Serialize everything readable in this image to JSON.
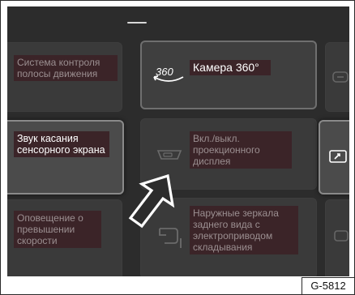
{
  "menu": {
    "items": [
      {
        "label": "Система контроля полосы движения",
        "icon": "lane-assist-icon"
      },
      {
        "label": "Камера 360°",
        "icon": "camera-360-icon",
        "icon_text": "360"
      },
      {
        "label": "Звук касания сенсорного экрана",
        "icon": "touch-sound-icon"
      },
      {
        "label": "Вкл./выкл. проекционного дисплея",
        "icon": "head-up-display-icon"
      },
      {
        "label": "Оповещение о превышении скорости",
        "icon": "speed-warning-icon"
      },
      {
        "label": "Наружные зеркала заднего вида с электроприводом складывания",
        "icon": "mirror-fold-icon"
      }
    ]
  },
  "figure_code": "G-5812",
  "colors": {
    "screen_bg": "#2c2c2c",
    "label_bg": "#3b2428",
    "dim_text": "#9b8f91",
    "bright_text": "#ffffff"
  }
}
